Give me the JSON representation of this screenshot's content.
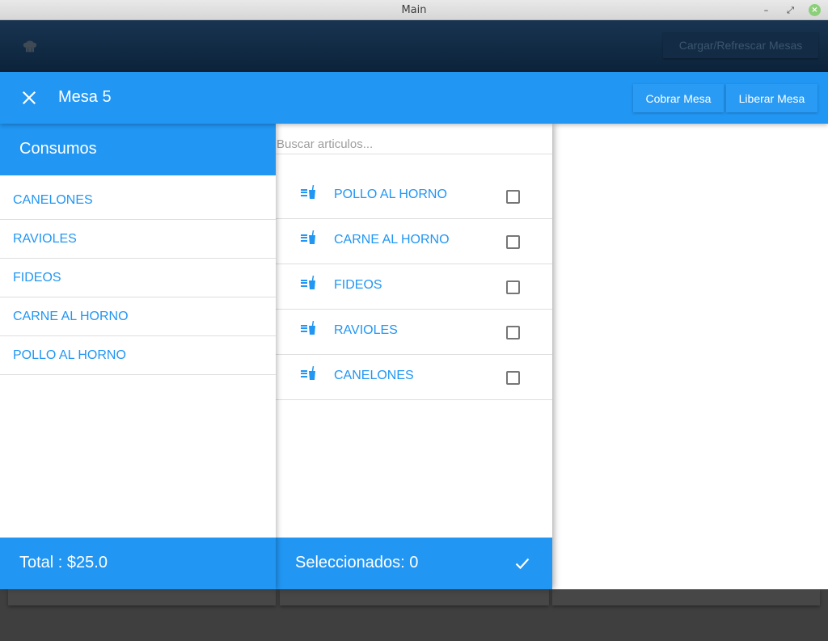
{
  "window": {
    "title": "Main",
    "min_glyph": "–",
    "max_glyph": "⤢",
    "close_glyph": "×"
  },
  "appbar": {
    "refresh_label": "Cargar/Refrescar Mesas",
    "icon": "chef-hat-icon"
  },
  "dialog": {
    "title": "Mesa 5",
    "cobrar_label": "Cobrar Mesa",
    "liberar_label": "Liberar Mesa"
  },
  "consumos": {
    "header": "Consumos",
    "items": [
      "CANELONES",
      "RAVIOLES",
      "FIDEOS",
      "CARNE AL HORNO",
      "POLLO AL HORNO"
    ],
    "total_label": "Total : $25.0"
  },
  "articulos": {
    "search_placeholder": "Buscar articulos...",
    "items": [
      {
        "label": "POLLO AL HORNO",
        "checked": false
      },
      {
        "label": "CARNE AL HORNO",
        "checked": false
      },
      {
        "label": "FIDEOS",
        "checked": false
      },
      {
        "label": "RAVIOLES",
        "checked": false
      },
      {
        "label": "CANELONES",
        "checked": false
      }
    ],
    "icon": "food-drink-icon",
    "selected_label": "Seleccionados: 0"
  },
  "colors": {
    "primary": "#2196f3",
    "appbar": "#0c233a",
    "backdrop": "#3f3f3f"
  }
}
